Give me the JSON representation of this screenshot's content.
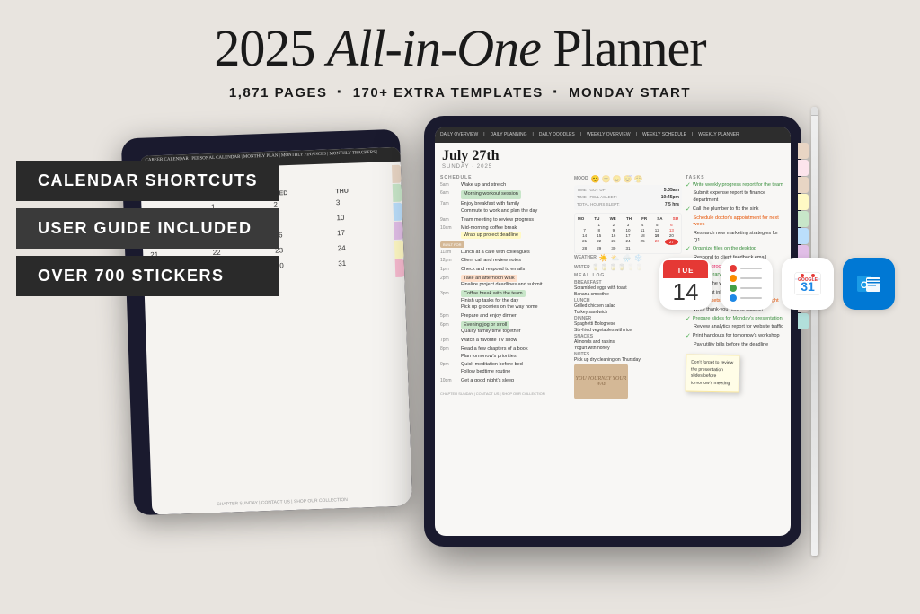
{
  "page": {
    "background": "#e8e4df"
  },
  "header": {
    "title_part1": "2025 ",
    "title_part2": "All-in-One",
    "title_part3": " Planner",
    "stat1": "1,871 PAGES",
    "dot1": "·",
    "stat2": "170+ EXTRA TEMPLATES",
    "dot2": "·",
    "stat3": "MONDAY START"
  },
  "badges": {
    "shortcuts": "CALENDAR SHORTCUTS",
    "guide": "USER GUIDE INCLUDED",
    "stickers": "OVER 700 STICKERS"
  },
  "app_icons": {
    "calendar_day": "14",
    "calendar_day_label": "TUE"
  },
  "planner": {
    "date": "July 27th",
    "day": "SUNDAY · 2025",
    "nav_tabs": [
      "DAILY OVERVIEW",
      "DAILY PLANNING",
      "DAILY DOODLES",
      "WEEKLY OVERVIEW",
      "WEEKLY SCHEDULE",
      "WEEKLY PLANNER"
    ]
  },
  "schedule": {
    "label": "SCHEDULE",
    "items": [
      {
        "time": "5am",
        "text": "Wake up and stretch"
      },
      {
        "time": "6am",
        "text": "Morning workout session",
        "highlight": "green"
      },
      {
        "time": "7am",
        "text": "Enjoy breakfast with family"
      },
      {
        "time": "8am",
        "text": "Commute to work and plan the day"
      },
      {
        "time": "9am",
        "text": "Team meeting to review progress"
      },
      {
        "time": "10am",
        "text": "Mid-morning coffee break"
      },
      {
        "time": "",
        "text": "Wrap up project deadline",
        "highlight": "yellow"
      },
      {
        "time": "11am",
        "text": "Lunch at a café with colleagues"
      },
      {
        "time": "12pm",
        "text": "Client call and review notes"
      },
      {
        "time": "1pm",
        "text": "Check and respond to emails"
      },
      {
        "time": "2pm",
        "text": "Take an afternoon walk",
        "highlight": "orange"
      },
      {
        "time": "",
        "text": "Finalize project deadlines and submit"
      },
      {
        "time": "3pm",
        "text": "Coffee break with the team",
        "highlight": "green"
      },
      {
        "time": "",
        "text": "Finish up tasks for the day"
      },
      {
        "time": "",
        "text": "Pick up groceries on the way home"
      },
      {
        "time": "5pm",
        "text": "Prepare and enjoy dinner"
      },
      {
        "time": "6pm",
        "text": "Evening jog or stroll",
        "highlight": "green"
      },
      {
        "time": "",
        "text": "Quality family time together"
      },
      {
        "time": "7pm",
        "text": "Watch a favorite TV show"
      },
      {
        "time": "8pm",
        "text": "Read a few chapters of a book"
      },
      {
        "time": "",
        "text": "Plan tomorrow's priorities"
      },
      {
        "time": "9pm",
        "text": "Quick meditation before bed"
      },
      {
        "time": "",
        "text": "Follow bedtime routine"
      },
      {
        "time": "10pm",
        "text": "Get a good night's sleep"
      }
    ]
  },
  "tasks": {
    "label": "TASKS",
    "items": [
      {
        "text": "Write weekly progress report for the team",
        "done": true,
        "color": "green"
      },
      {
        "text": "Submit expense report to finance department",
        "done": false
      },
      {
        "text": "Call the plumber to fix the sink",
        "done": true
      },
      {
        "text": "Schedule doctor's appointment for next week",
        "done": false,
        "color": "orange"
      },
      {
        "text": "Research new marketing strategies for Q1",
        "done": false
      },
      {
        "text": "Organize files on the desktop",
        "done": true,
        "color": "green"
      },
      {
        "text": "Respond to client feedback email",
        "done": false
      },
      {
        "text": "Pick up groceries for dinner tonight",
        "done": false,
        "color": "pink"
      },
      {
        "text": "Plan itinerary for weekend trip",
        "done": true,
        "color": "green"
      },
      {
        "text": "Update the website landing page",
        "done": false
      },
      {
        "text": "Clean out inbox to zero emails",
        "done": false
      },
      {
        "text": "Book tickets for Saturday's movie night",
        "done": false,
        "color": "orange"
      },
      {
        "text": "Write thank-you note to supplier",
        "done": false
      },
      {
        "text": "Prepare slides for Monday's presentation",
        "done": true,
        "color": "green"
      },
      {
        "text": "Review analytics report for website traffic",
        "done": false
      },
      {
        "text": "Print handouts for tomorrow's workshop",
        "done": true
      },
      {
        "text": "Pay utility bills before the deadline",
        "done": false
      }
    ]
  },
  "meal_log": {
    "label": "MEAL LOG",
    "breakfast_label": "BREAKFAST",
    "breakfast": [
      "Scrambled eggs with toast",
      "Banana smoothie"
    ],
    "lunch_label": "LUNCH",
    "lunch": [
      "Grilled chicken salad",
      "Turkey sandwich"
    ],
    "dinner_label": "DINNER",
    "dinner": [
      "Spaghetti Bolognese",
      "Stir-fried vegetables with rice"
    ],
    "snacks_label": "SNACKS",
    "snacks": [
      "Almonds and raisins",
      "Yogurt with honey"
    ],
    "notes_label": "NOTES",
    "notes": "Pick up dry cleaning on Thursday"
  },
  "tracker": {
    "mood_label": "MOOD",
    "wake_label": "TIME I GOT UP:",
    "wake_time": "5:05am",
    "sleep_label": "TIME I FELL ASLEEP:",
    "sleep_time": "10:45pm",
    "total_label": "TOTAL HOURS SLEPT:",
    "total_hours": "7.5 hrs",
    "water_label": "WATER"
  },
  "sticky_note": {
    "text": "Don't forget to review the presentation slides before tomorrow's meeting"
  },
  "image_placeholder": {
    "text": "YOU JOURNEY YOUR WAY"
  },
  "mini_cal": {
    "headers": [
      "MO",
      "TU",
      "WE",
      "TH",
      "FR",
      "SA",
      "SU"
    ],
    "weeks": [
      [
        "",
        "",
        "1",
        "2",
        "3",
        "4",
        "5"
      ],
      [
        "6",
        "7",
        "8",
        "9",
        "10",
        "11",
        "12"
      ],
      [
        "13",
        "14",
        "15",
        "16",
        "17",
        "18",
        "19"
      ],
      [
        "20",
        "21",
        "22",
        "23",
        "24",
        "25",
        "26"
      ],
      [
        "27",
        "28",
        "29",
        "30",
        "31",
        "",
        ""
      ]
    ]
  }
}
